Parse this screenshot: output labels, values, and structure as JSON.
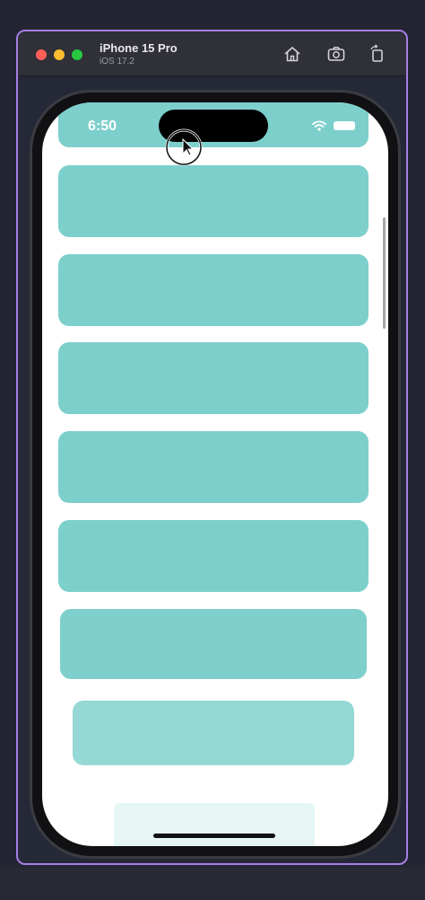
{
  "window": {
    "device_name": "iPhone 15 Pro",
    "os_version": "iOS 17.2",
    "toolbar": {
      "home_icon": "home-icon",
      "screenshot_icon": "camera-icon",
      "rotate_icon": "rotate-icon"
    },
    "frame_color": "#a67fe6"
  },
  "status_bar": {
    "time": "6:50",
    "icons": [
      "wifi-icon",
      "battery-icon"
    ]
  },
  "app": {
    "card_color": "#7dcfcc",
    "cards": [
      {
        "id": "card-1"
      },
      {
        "id": "card-2"
      },
      {
        "id": "card-3"
      },
      {
        "id": "card-4"
      },
      {
        "id": "card-5"
      },
      {
        "id": "card-6"
      },
      {
        "id": "card-7"
      },
      {
        "id": "card-8"
      },
      {
        "id": "card-9"
      }
    ]
  }
}
